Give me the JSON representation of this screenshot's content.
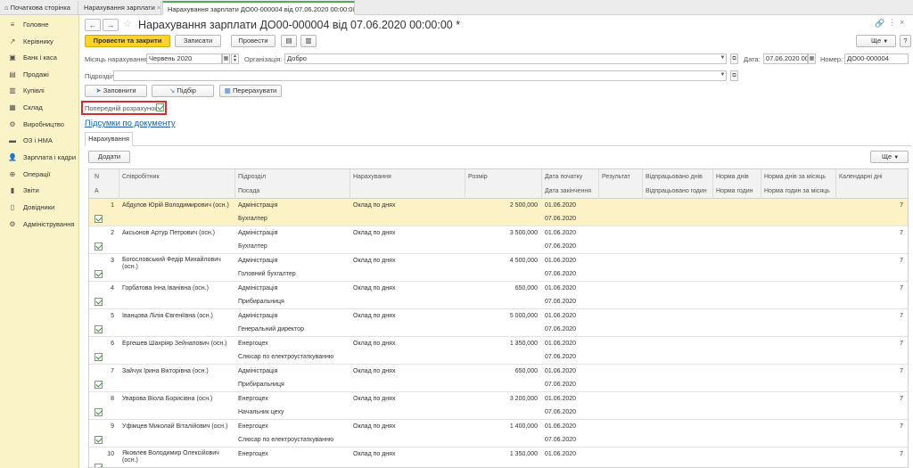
{
  "tabs": [
    {
      "label": "Початкова сторінка"
    },
    {
      "label": "Нарахування зарплати"
    },
    {
      "label": "Нарахування зарплати ДО00-000004 від 07.06.2020 00:00:00 *"
    }
  ],
  "sidebar": {
    "items": [
      {
        "label": "Головне",
        "icon": "≡"
      },
      {
        "label": "Керівнику",
        "icon": "↗"
      },
      {
        "label": "Банк і каса",
        "icon": "▣"
      },
      {
        "label": "Продажі",
        "icon": "▤"
      },
      {
        "label": "Купівлі",
        "icon": "▥"
      },
      {
        "label": "Склад",
        "icon": "▦"
      },
      {
        "label": "Виробництво",
        "icon": "⚙"
      },
      {
        "label": "ОЗ і НМА",
        "icon": "▬"
      },
      {
        "label": "Зарплата і кадри",
        "icon": "👤"
      },
      {
        "label": "Операції",
        "icon": "⊕"
      },
      {
        "label": "Звіти",
        "icon": "▮"
      },
      {
        "label": "Довідники",
        "icon": "▯"
      },
      {
        "label": "Адміністрування",
        "icon": "⚙"
      }
    ]
  },
  "doc": {
    "title": "Нарахування зарплати ДО00-000004 від 07.06.2020 00:00:00 *",
    "btn_post_close": "Провести та закрити",
    "btn_save": "Записати",
    "btn_post": "Провести",
    "btn_more": "Ще",
    "help": "?"
  },
  "form": {
    "month_label": "Місяць нарахування:",
    "month_value": "Червень 2020",
    "org_label": "Організація:",
    "org_value": "Добро",
    "date_label": "Дата:",
    "date_value": "07.06.2020 00",
    "number_label": "Номер:",
    "number_value": "ДО00-000004",
    "dept_label": "Підрозділ:",
    "dept_value": "",
    "btn_fill": "Заповнити",
    "btn_select": "Підбір",
    "btn_recalc": "Перерахувати",
    "prelim_label": "Попередній розрахунок:",
    "totals_link": "Підсумки по документу",
    "tab_accruals": "Нарахування",
    "btn_add": "Додати"
  },
  "table": {
    "headers": {
      "n": "N",
      "a": "А",
      "employee": "Співробітник",
      "dept": "Підрозділ",
      "position": "Посада",
      "accrual": "Нарахування",
      "amount": "Розмір",
      "date_start": "Дата початку",
      "date_end": "Дата закінчення",
      "result": "Результат",
      "days_worked": "Відпрацьовано днів",
      "hours_worked": "Відпрацьовано годин",
      "norm_days": "Норма днів",
      "norm_hours": "Норма годин",
      "norm_days_month": "Норма днів за місяць",
      "norm_hours_month": "Норма годин за місяць",
      "calendar_days": "Календарні дні"
    },
    "rows": [
      {
        "n": "1",
        "employee": "Абдулов Юрій Володимирович (осн.)",
        "dept": "Адміністрація",
        "position": "Бухгалтер",
        "accrual": "Оклад по днях",
        "amount": "2 500,000",
        "date_start": "01.06.2020",
        "date_end": "07.06.2020",
        "cal": "7"
      },
      {
        "n": "2",
        "employee": "Аксьонов Артур Петрович (осн.)",
        "dept": "Адміністрація",
        "position": "Бухгалтер",
        "accrual": "Оклад по днях",
        "amount": "3 500,000",
        "date_start": "01.06.2020",
        "date_end": "07.06.2020",
        "cal": "7"
      },
      {
        "n": "3",
        "employee": "Богословський Федір Михайлович (осн.)",
        "dept": "Адміністрація",
        "position": "Головний бухгалтер",
        "accrual": "Оклад по днях",
        "amount": "4 500,000",
        "date_start": "01.06.2020",
        "date_end": "07.06.2020",
        "cal": "7"
      },
      {
        "n": "4",
        "employee": "Горбатова Інна Іванівна (осн.)",
        "dept": "Адміністрація",
        "position": "Прибиральниця",
        "accrual": "Оклад по днях",
        "amount": "650,000",
        "date_start": "01.06.2020",
        "date_end": "07.06.2020",
        "cal": "7"
      },
      {
        "n": "5",
        "employee": "Іванцова Лілія Євгеніївна (осн.)",
        "dept": "Адміністрація",
        "position": "Генеральний директор",
        "accrual": "Оклад по днях",
        "amount": "5 000,000",
        "date_start": "01.06.2020",
        "date_end": "07.06.2020",
        "cal": "7"
      },
      {
        "n": "6",
        "employee": "Ергешев Шахріяр Зейнапович (осн.)",
        "dept": "Енергоцех",
        "position": "Слюсар по електроустаткуванню",
        "accrual": "Оклад по днях",
        "amount": "1 350,000",
        "date_start": "01.06.2020",
        "date_end": "07.06.2020",
        "cal": "7"
      },
      {
        "n": "7",
        "employee": "Зайчук Ірина Вікторівна (осн.)",
        "dept": "Адміністрація",
        "position": "Прибиральниця",
        "accrual": "Оклад по днях",
        "amount": "650,000",
        "date_start": "01.06.2020",
        "date_end": "07.06.2020",
        "cal": "7"
      },
      {
        "n": "8",
        "employee": "Уварова Віола Борисівна (осн.)",
        "dept": "Енергоцех",
        "position": "Начальник цеху",
        "accrual": "Оклад по днях",
        "amount": "3 200,000",
        "date_start": "01.06.2020",
        "date_end": "07.06.2020",
        "cal": "7"
      },
      {
        "n": "9",
        "employee": "Уфімцев Миколай Віталійович (осн.)",
        "dept": "Енергоцех",
        "position": "Слюсар по електроустаткуванню",
        "accrual": "Оклад по днях",
        "amount": "1 400,000",
        "date_start": "01.06.2020",
        "date_end": "07.06.2020",
        "cal": "7"
      },
      {
        "n": "10",
        "employee": "Яковлев Володимир Олексійович (осн.)",
        "dept": "Енергоцех",
        "position": "",
        "accrual": "Оклад по днях",
        "amount": "1 350,000",
        "date_start": "01.06.2020",
        "date_end": "",
        "cal": "7"
      }
    ]
  }
}
